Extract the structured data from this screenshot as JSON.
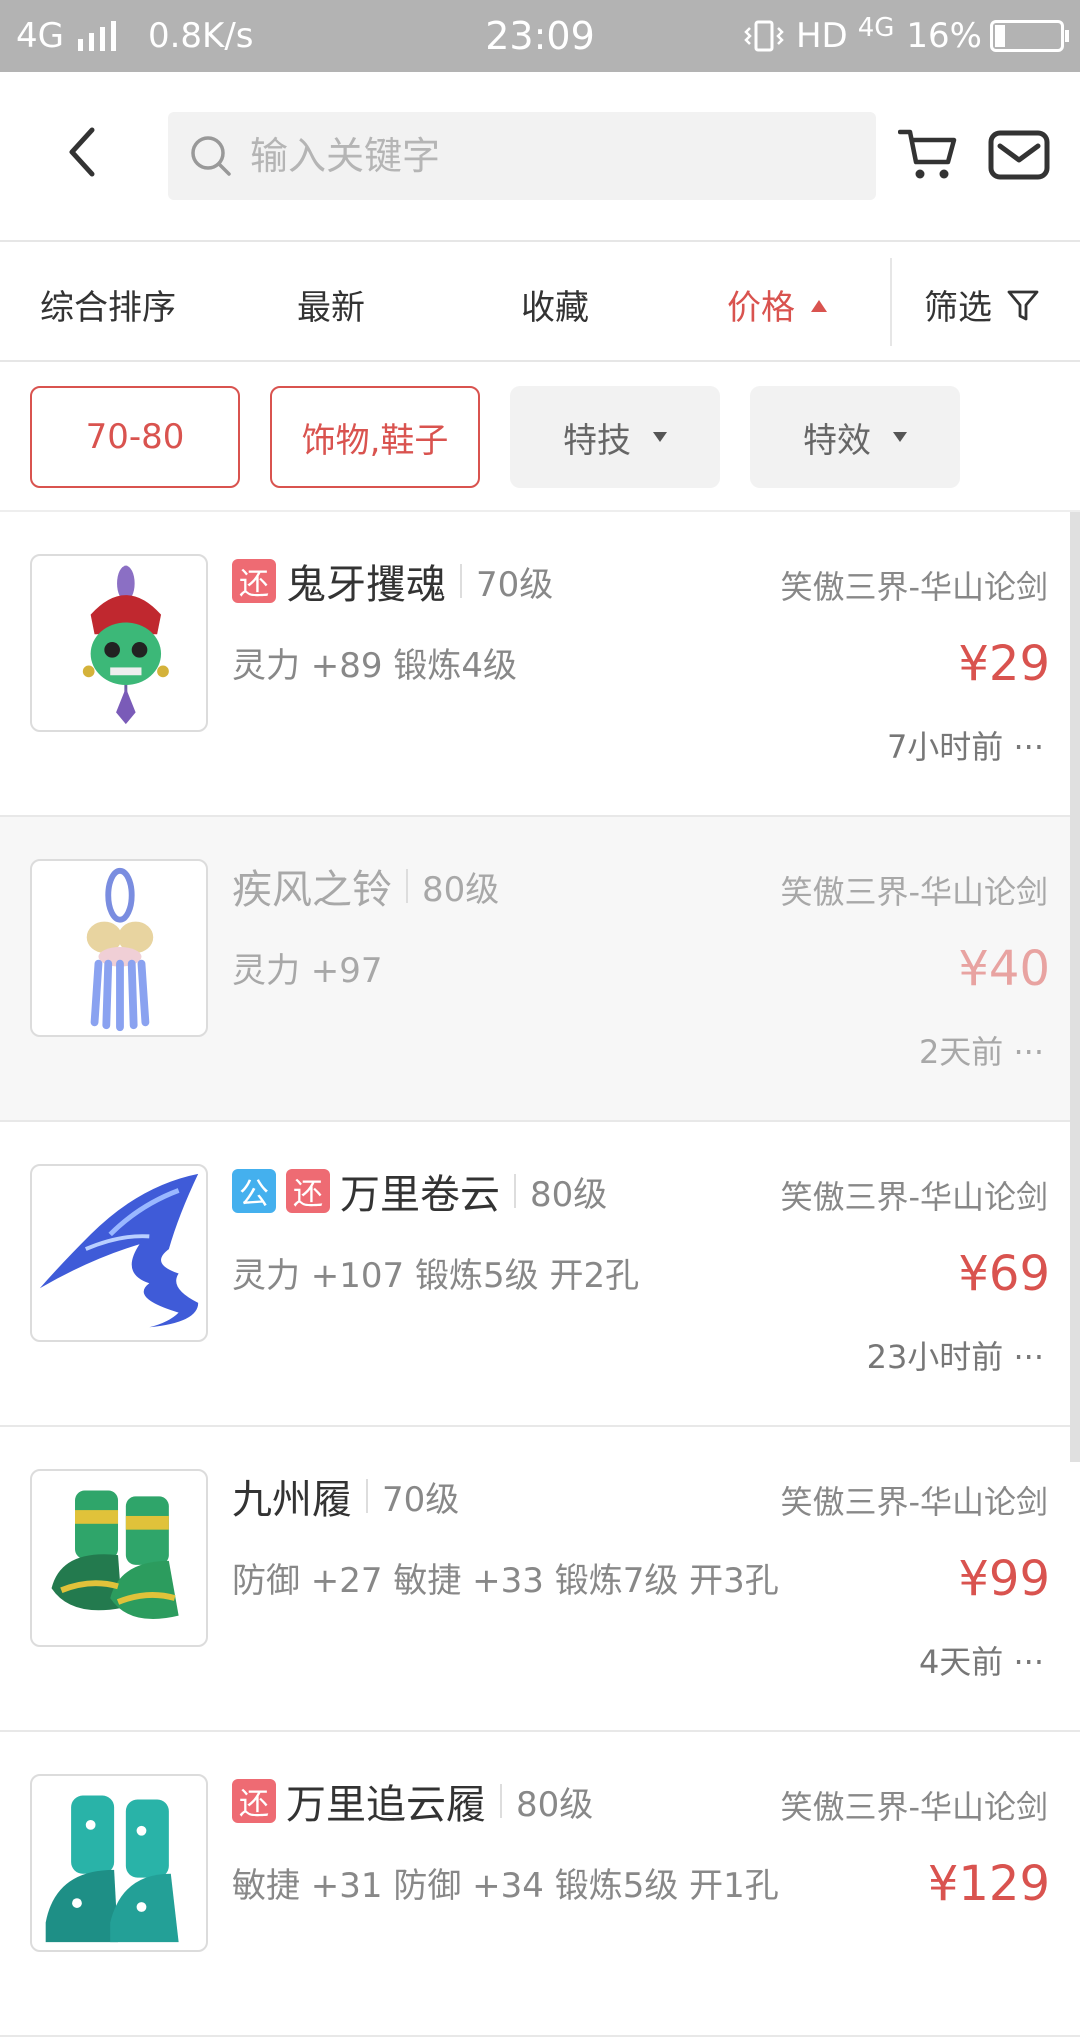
{
  "status": {
    "network": "4G",
    "speed": "0.8K/s",
    "time": "23:09",
    "hd": "HD",
    "net_right": "4G",
    "battery": "16%",
    "battery_level": 0.16
  },
  "search": {
    "placeholder": "输入关键字"
  },
  "sort": {
    "items": [
      {
        "label": "综合排序"
      },
      {
        "label": "最新"
      },
      {
        "label": "收藏"
      },
      {
        "label": "价格"
      }
    ],
    "filter_label": "筛选"
  },
  "chips": [
    {
      "label": "70-80"
    },
    {
      "label": "饰物,鞋子"
    },
    {
      "label": "特技"
    },
    {
      "label": "特效"
    }
  ],
  "items": [
    {
      "badges": [
        "还"
      ],
      "name": "鬼牙攫魂",
      "level": "70级",
      "server": "笑傲三界-华山论剑",
      "attrs": "灵力 +89 锻炼4级",
      "price": "¥29",
      "time": "7小时前 ···"
    },
    {
      "badges": [],
      "name": "疾风之铃",
      "level": "80级",
      "server": "笑傲三界-华山论剑",
      "attrs": "灵力 +97",
      "price": "¥40",
      "time": "2天前 ···"
    },
    {
      "badges": [
        "公",
        "还"
      ],
      "name": "万里卷云",
      "level": "80级",
      "server": "笑傲三界-华山论剑",
      "attrs": "灵力 +107 锻炼5级 开2孔",
      "price": "¥69",
      "time": "23小时前 ···"
    },
    {
      "badges": [],
      "name": "九州履",
      "level": "70级",
      "server": "笑傲三界-华山论剑",
      "attrs": "防御 +27 敏捷 +33 锻炼7级 开3孔",
      "price": "¥99",
      "time": "4天前 ···"
    },
    {
      "badges": [
        "还"
      ],
      "name": "万里追云履",
      "level": "80级",
      "server": "笑傲三界-华山论剑",
      "attrs": "敏捷 +31 防御 +34 锻炼5级 开1孔",
      "price": "¥129",
      "time": ""
    }
  ],
  "colors": {
    "accent": "#d9534f",
    "badge_red": "#ee6b73",
    "badge_blue": "#44b0ee",
    "status_bar": "#b3b3b3"
  }
}
